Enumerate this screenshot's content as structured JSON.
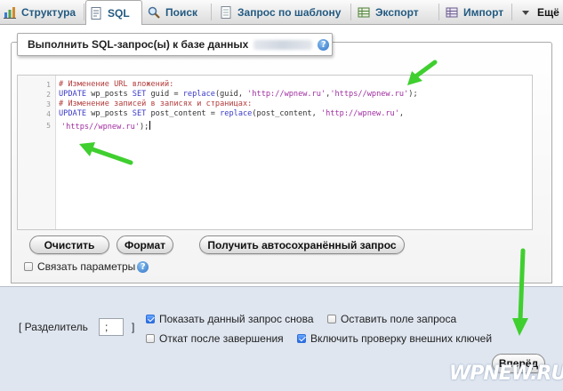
{
  "tabs": [
    {
      "label": "Структура",
      "icon": "structure-icon",
      "active": false
    },
    {
      "label": "SQL",
      "icon": "sql-icon",
      "active": true
    },
    {
      "label": "Поиск",
      "icon": "search-icon",
      "active": false
    },
    {
      "label": "Запрос по шаблону",
      "icon": "query-template-icon",
      "active": false
    },
    {
      "label": "Экспорт",
      "icon": "export-icon",
      "active": false
    },
    {
      "label": "Импорт",
      "icon": "import-icon",
      "active": false
    },
    {
      "label": "Ещё",
      "icon": "chevron-down-icon",
      "active": false
    }
  ],
  "panel": {
    "legend": "Выполнить SQL-запрос(ы) к базе данных",
    "help_glyph": "?"
  },
  "editor": {
    "line_numbers": [
      "1",
      "2",
      "3",
      "4",
      "5"
    ],
    "lines": [
      [
        {
          "t": "# Изменение URL вложений:",
          "k": "comment"
        }
      ],
      [
        {
          "t": "UPDATE",
          "k": "kw"
        },
        {
          "t": " wp_posts ",
          "k": "txt"
        },
        {
          "t": "SET",
          "k": "kw"
        },
        {
          "t": " guid = ",
          "k": "txt"
        },
        {
          "t": "replace",
          "k": "kw"
        },
        {
          "t": "(guid, ",
          "k": "txt"
        },
        {
          "t": "'http://wpnew.ru'",
          "k": "str"
        },
        {
          "t": ",",
          "k": "txt"
        },
        {
          "t": "'https//wpnew.ru'",
          "k": "str"
        },
        {
          "t": ");",
          "k": "txt"
        }
      ],
      [
        {
          "t": "# Изменение записей в записях и страницах:",
          "k": "comment"
        }
      ],
      [
        {
          "t": "UPDATE",
          "k": "kw"
        },
        {
          "t": " wp_posts ",
          "k": "txt"
        },
        {
          "t": "SET",
          "k": "kw"
        },
        {
          "t": " post_content = ",
          "k": "txt"
        },
        {
          "t": "replace",
          "k": "kw"
        },
        {
          "t": "(post_content, ",
          "k": "txt"
        },
        {
          "t": "'http://wpnew.ru'",
          "k": "str"
        },
        {
          "t": ",",
          "k": "txt"
        }
      ],
      [
        {
          "t": "'https//wpnew.ru'",
          "k": "str"
        },
        {
          "t": ");",
          "k": "txt"
        }
      ]
    ]
  },
  "buttons": {
    "clear": "Очистить",
    "format": "Формат",
    "autosaved": "Получить автосохранённый запрос",
    "go": "Вперёд"
  },
  "bind_params": {
    "label": "Связать параметры",
    "checked": false
  },
  "options": {
    "delimiter_label": "[ Разделитель",
    "delimiter_close": "]",
    "delimiter_value": ";",
    "show_query": {
      "label": "Показать данный запрос снова",
      "checked": true
    },
    "keep_query": {
      "label": "Оставить поле запроса",
      "checked": false
    },
    "rollback": {
      "label": "Откат после завершения",
      "checked": false
    },
    "foreign_keys": {
      "label": "Включить проверку внешних ключей",
      "checked": true
    }
  },
  "watermark": "WPNEW.RU",
  "colors": {
    "tab_text": "#235a81",
    "annotation_arrow": "#3fcf2f",
    "bottom_panel": "#dfe6f0"
  }
}
